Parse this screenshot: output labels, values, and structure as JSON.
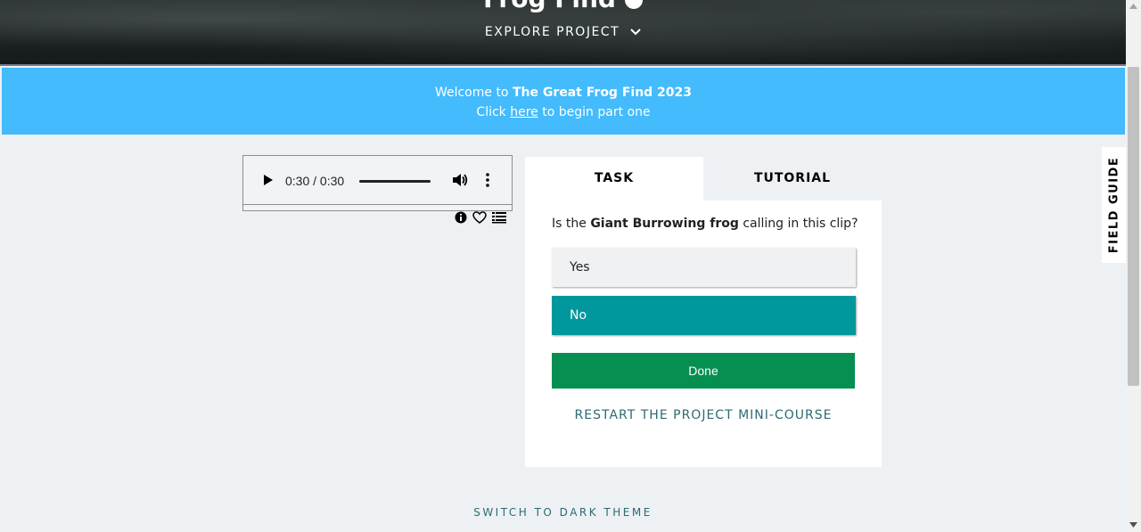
{
  "hero": {
    "title": "Frog Find",
    "explore_label": "EXPLORE PROJECT"
  },
  "banner": {
    "welcome_prefix": "Welcome to ",
    "project_name": "The Great Frog Find 2023",
    "click_prefix": "Click ",
    "link_text": "here",
    "click_suffix": " to begin part one"
  },
  "audio": {
    "time": "0:30 / 0:30",
    "progress": 1.0
  },
  "tabs": [
    {
      "label": "TASK",
      "active": true
    },
    {
      "label": "TUTORIAL",
      "active": false
    }
  ],
  "task": {
    "question_prefix": "Is the ",
    "question_bold": "Giant Burrowing frog",
    "question_suffix": " calling in this clip?",
    "answers": [
      {
        "label": "Yes",
        "selected": false
      },
      {
        "label": "No",
        "selected": true
      }
    ],
    "done_label": "Done",
    "restart_label": "RESTART THE PROJECT MINI-COURSE"
  },
  "field_guide": {
    "label": "FIELD GUIDE"
  },
  "footer": {
    "dark_theme_label": "SWITCH TO DARK THEME"
  },
  "colors": {
    "banner": "#43bbfd",
    "selected_answer": "#00979d",
    "done_button": "#078f52",
    "link_teal": "#2b6a73"
  }
}
